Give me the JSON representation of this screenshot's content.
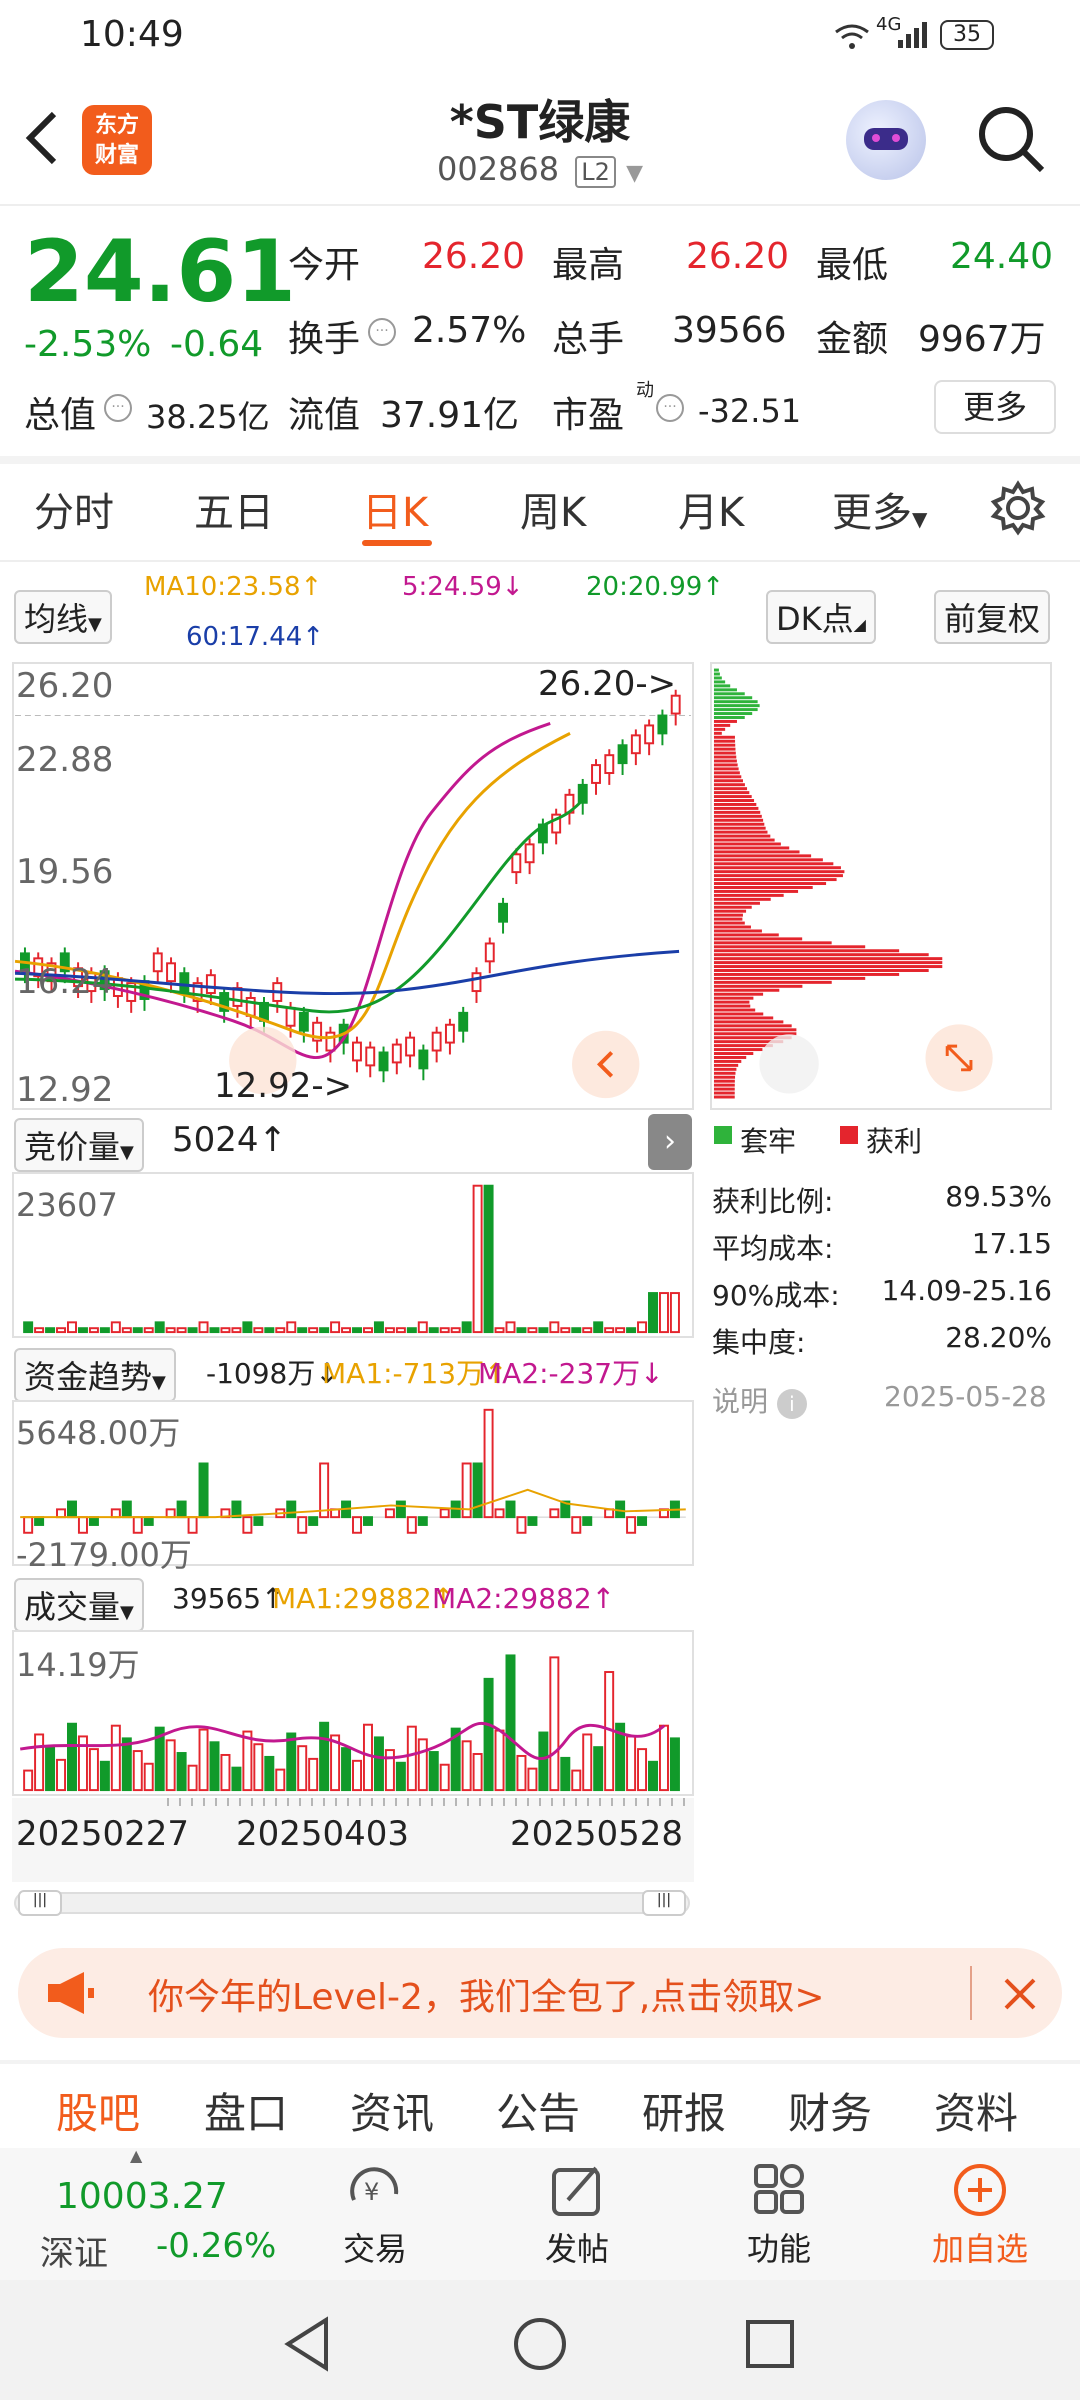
{
  "status": {
    "time": "10:49",
    "signal": "4G",
    "battery": "35"
  },
  "header": {
    "logo_line1": "东方",
    "logo_line2": "财富",
    "title": "*ST绿康",
    "code": "002868",
    "level": "L2"
  },
  "quote": {
    "price": "24.61",
    "change_pct": "-2.53%",
    "change": "-0.64",
    "open_label": "今开",
    "open": "26.20",
    "high_label": "最高",
    "high": "26.20",
    "low_label": "最低",
    "low": "24.40",
    "turnover_label": "换手",
    "turnover": "2.57%",
    "volume_label": "总手",
    "volume": "39566",
    "amount_label": "金额",
    "amount": "9967万",
    "mktcap_label": "总值",
    "mktcap": "38.25亿",
    "float_label": "流值",
    "float": "37.91亿",
    "pe_label": "市盈",
    "pe_sup": "动",
    "pe": "-32.51",
    "more": "更多"
  },
  "tabs": [
    "分时",
    "五日",
    "日K",
    "周K",
    "月K",
    "更多"
  ],
  "ma": {
    "chip": "均线",
    "ma10": "MA10:23.58↑",
    "ma5": "5:24.59↓",
    "ma20": "20:20.99↑",
    "ma60": "60:17.44↑",
    "dk": "DK点",
    "fq": "前复权"
  },
  "kline": {
    "y_top": "26.20",
    "y_2": "22.88",
    "y_3": "19.56",
    "y_4": "16.24",
    "y_bottom": "12.92",
    "hi_note": "26.20->",
    "lo_note": "12.92->"
  },
  "auction": {
    "chip": "竞价量",
    "value": "5024↑",
    "max": "23607"
  },
  "fund": {
    "chip": "资金趋势",
    "value": "-1098万↓",
    "ma1": "MA1:-713万↑",
    "ma2": "MA2:-237万↓",
    "max": "5648.00万",
    "min": "-2179.00万"
  },
  "vol": {
    "chip": "成交量",
    "value": "39565↑",
    "ma1": "MA1:29882↑",
    "ma2": "MA2:29882↑",
    "max": "14.19万"
  },
  "dates": [
    "20250227",
    "20250403",
    "20250528"
  ],
  "chips_dist": {
    "legend_trap": "套牢",
    "legend_profit": "获利",
    "rows": [
      {
        "label": "获利比例:",
        "value": "89.53%"
      },
      {
        "label": "平均成本:",
        "value": "17.15"
      },
      {
        "label": "90%成本:",
        "value": "14.09-25.16"
      },
      {
        "label": "集中度:",
        "value": "28.20%"
      }
    ],
    "note": "说明",
    "date": "2025-05-28"
  },
  "banner": "你今年的Level-2，我们全包了,点击领取>",
  "bottom_tabs": [
    "股吧",
    "盘口",
    "资讯",
    "公告",
    "研报",
    "财务",
    "资料"
  ],
  "index": {
    "value": "10003.27",
    "name": "深证",
    "change": "-0.26%"
  },
  "actions": [
    "交易",
    "发帖",
    "功能",
    "加自选"
  ],
  "colors": {
    "up": "#e4252d",
    "down": "#119a2a",
    "accent": "#f25c1c"
  }
}
